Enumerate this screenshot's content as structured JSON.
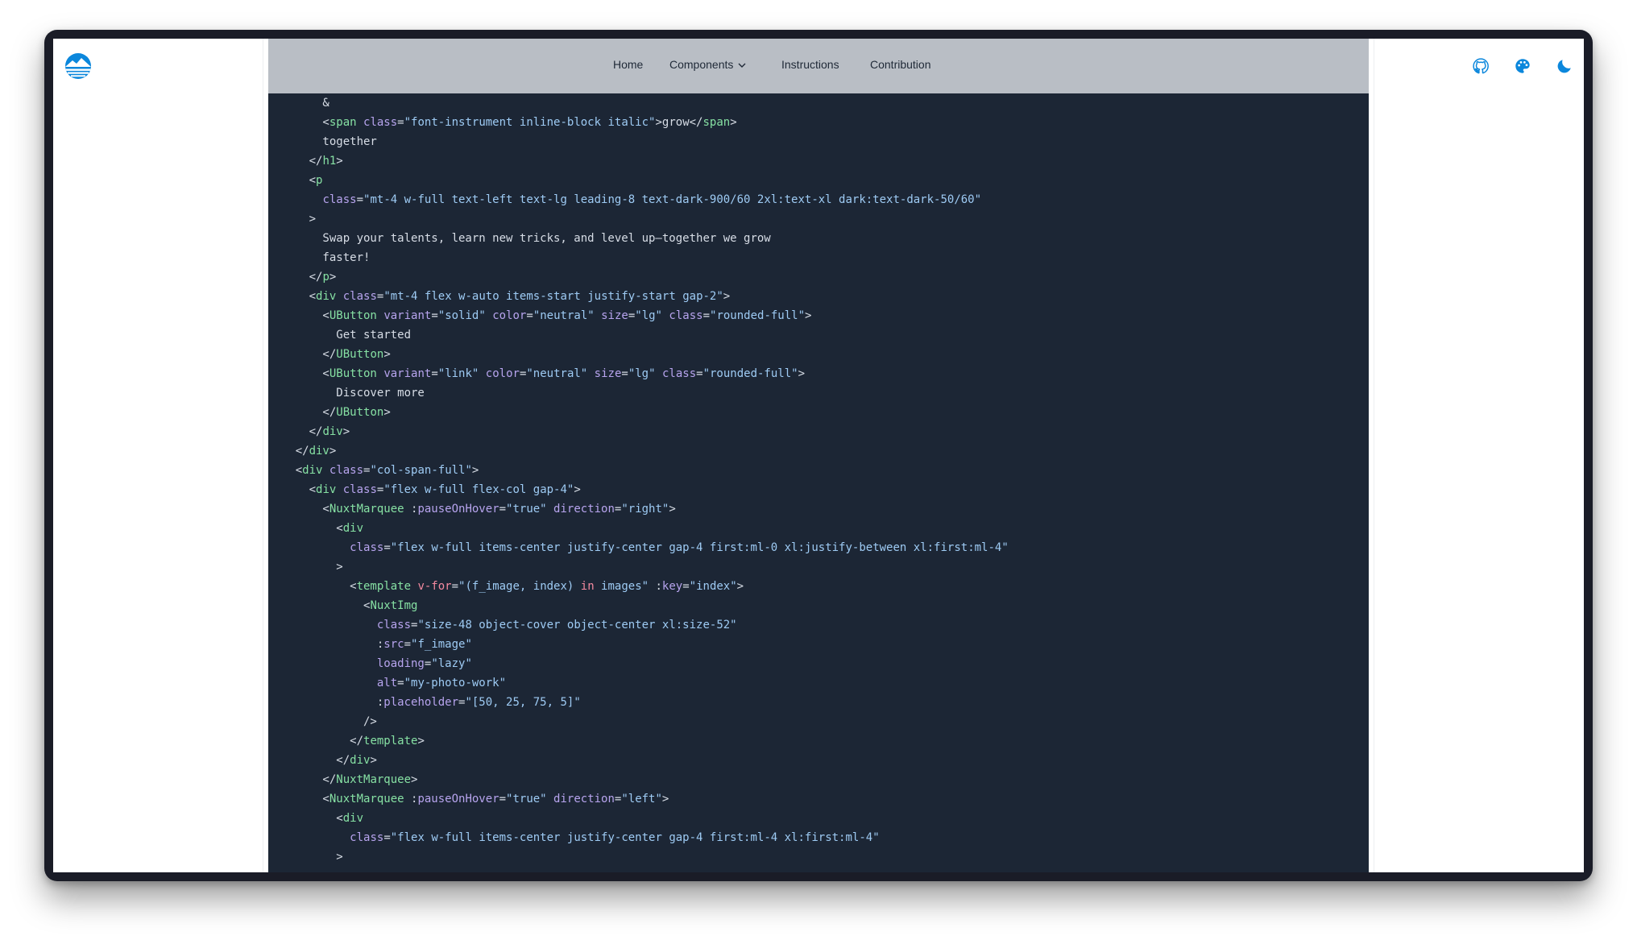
{
  "nav": {
    "home": "Home",
    "components": "Components",
    "instructions": "Instructions",
    "contribution": "Contribution"
  },
  "icons": {
    "logo": "cloud-sun-logo",
    "github": "github-icon",
    "palette": "palette-icon",
    "theme": "moon-icon"
  },
  "colors": {
    "accent": "#0b87dc",
    "code_background": "#1c2635",
    "tag": "#86e0a3",
    "attribute": "#b7a4ee",
    "string": "#9ecbf4",
    "keyword": "#f58aa0",
    "text": "#d7dde6"
  },
  "code": {
    "lines": [
      [
        [
          "t",
          "        &"
        ]
      ],
      [
        [
          "t",
          "        <"
        ],
        [
          "tag",
          "span"
        ],
        [
          "t",
          " "
        ],
        [
          "attr",
          "class"
        ],
        [
          "t",
          "="
        ],
        [
          "val",
          "\"font-instrument inline-block italic\""
        ],
        [
          "t",
          ">grow</"
        ],
        [
          "tag",
          "span"
        ],
        [
          "t",
          ">"
        ]
      ],
      [
        [
          "t",
          "        together"
        ]
      ],
      [
        [
          "t",
          "      </"
        ],
        [
          "tag",
          "h1"
        ],
        [
          "t",
          ">"
        ]
      ],
      [
        [
          "t",
          "      <"
        ],
        [
          "tag",
          "p"
        ]
      ],
      [
        [
          "t",
          "        "
        ],
        [
          "attr",
          "class"
        ],
        [
          "t",
          "="
        ],
        [
          "val",
          "\"mt-4 w-full text-left text-lg leading-8 text-dark-900/60 2xl:text-xl dark:text-dark-50/60\""
        ]
      ],
      [
        [
          "t",
          "      >"
        ]
      ],
      [
        [
          "t",
          "        Swap your talents, learn new tricks, and level up—together we grow"
        ]
      ],
      [
        [
          "t",
          "        faster!"
        ]
      ],
      [
        [
          "t",
          "      </"
        ],
        [
          "tag",
          "p"
        ],
        [
          "t",
          ">"
        ]
      ],
      [
        [
          "t",
          "      <"
        ],
        [
          "tag",
          "div"
        ],
        [
          "t",
          " "
        ],
        [
          "attr",
          "class"
        ],
        [
          "t",
          "="
        ],
        [
          "val",
          "\"mt-4 flex w-auto items-start justify-start gap-2\""
        ],
        [
          "t",
          ">"
        ]
      ],
      [
        [
          "t",
          "        <"
        ],
        [
          "tag",
          "UButton"
        ],
        [
          "t",
          " "
        ],
        [
          "attr",
          "variant"
        ],
        [
          "t",
          "="
        ],
        [
          "val",
          "\"solid\""
        ],
        [
          "t",
          " "
        ],
        [
          "attr",
          "color"
        ],
        [
          "t",
          "="
        ],
        [
          "val",
          "\"neutral\""
        ],
        [
          "t",
          " "
        ],
        [
          "attr",
          "size"
        ],
        [
          "t",
          "="
        ],
        [
          "val",
          "\"lg\""
        ],
        [
          "t",
          " "
        ],
        [
          "attr",
          "class"
        ],
        [
          "t",
          "="
        ],
        [
          "val",
          "\"rounded-full\""
        ],
        [
          "t",
          ">"
        ]
      ],
      [
        [
          "t",
          "          Get started"
        ]
      ],
      [
        [
          "t",
          "        </"
        ],
        [
          "tag",
          "UButton"
        ],
        [
          "t",
          ">"
        ]
      ],
      [
        [
          "t",
          "        <"
        ],
        [
          "tag",
          "UButton"
        ],
        [
          "t",
          " "
        ],
        [
          "attr",
          "variant"
        ],
        [
          "t",
          "="
        ],
        [
          "val",
          "\"link\""
        ],
        [
          "t",
          " "
        ],
        [
          "attr",
          "color"
        ],
        [
          "t",
          "="
        ],
        [
          "val",
          "\"neutral\""
        ],
        [
          "t",
          " "
        ],
        [
          "attr",
          "size"
        ],
        [
          "t",
          "="
        ],
        [
          "val",
          "\"lg\""
        ],
        [
          "t",
          " "
        ],
        [
          "attr",
          "class"
        ],
        [
          "t",
          "="
        ],
        [
          "val",
          "\"rounded-full\""
        ],
        [
          "t",
          ">"
        ]
      ],
      [
        [
          "t",
          "          Discover more"
        ]
      ],
      [
        [
          "t",
          "        </"
        ],
        [
          "tag",
          "UButton"
        ],
        [
          "t",
          ">"
        ]
      ],
      [
        [
          "t",
          "      </"
        ],
        [
          "tag",
          "div"
        ],
        [
          "t",
          ">"
        ]
      ],
      [
        [
          "t",
          "    </"
        ],
        [
          "tag",
          "div"
        ],
        [
          "t",
          ">"
        ]
      ],
      [
        [
          "t",
          "    <"
        ],
        [
          "tag",
          "div"
        ],
        [
          "t",
          " "
        ],
        [
          "attr",
          "class"
        ],
        [
          "t",
          "="
        ],
        [
          "val",
          "\"col-span-full\""
        ],
        [
          "t",
          ">"
        ]
      ],
      [
        [
          "t",
          "      <"
        ],
        [
          "tag",
          "div"
        ],
        [
          "t",
          " "
        ],
        [
          "attr",
          "class"
        ],
        [
          "t",
          "="
        ],
        [
          "val",
          "\"flex w-full flex-col gap-4\""
        ],
        [
          "t",
          ">"
        ]
      ],
      [
        [
          "t",
          "        <"
        ],
        [
          "tag",
          "NuxtMarquee"
        ],
        [
          "t",
          " :"
        ],
        [
          "attr",
          "pauseOnHover"
        ],
        [
          "t",
          "="
        ],
        [
          "val",
          "\"true\""
        ],
        [
          "t",
          " "
        ],
        [
          "attr",
          "direction"
        ],
        [
          "t",
          "="
        ],
        [
          "val",
          "\"right\""
        ],
        [
          "t",
          ">"
        ]
      ],
      [
        [
          "t",
          "          <"
        ],
        [
          "tag",
          "div"
        ]
      ],
      [
        [
          "t",
          "            "
        ],
        [
          "attr",
          "class"
        ],
        [
          "t",
          "="
        ],
        [
          "val",
          "\"flex w-full items-center justify-center gap-4 first:ml-0 xl:justify-between xl:first:ml-4\""
        ]
      ],
      [
        [
          "t",
          "          >"
        ]
      ],
      [
        [
          "t",
          "            <"
        ],
        [
          "tag",
          "template"
        ],
        [
          "t",
          " "
        ],
        [
          "kw",
          "v-for"
        ],
        [
          "t",
          "="
        ],
        [
          "val",
          "\"(f_image, index) "
        ],
        [
          "kw",
          "in"
        ],
        [
          "val",
          " images\""
        ],
        [
          "t",
          " :"
        ],
        [
          "attr",
          "key"
        ],
        [
          "t",
          "="
        ],
        [
          "val",
          "\"index\""
        ],
        [
          "t",
          ">"
        ]
      ],
      [
        [
          "t",
          "              <"
        ],
        [
          "tag",
          "NuxtImg"
        ]
      ],
      [
        [
          "t",
          "                "
        ],
        [
          "attr",
          "class"
        ],
        [
          "t",
          "="
        ],
        [
          "val",
          "\"size-48 object-cover object-center xl:size-52\""
        ]
      ],
      [
        [
          "t",
          "                :"
        ],
        [
          "attr",
          "src"
        ],
        [
          "t",
          "="
        ],
        [
          "val",
          "\"f_image\""
        ]
      ],
      [
        [
          "t",
          "                "
        ],
        [
          "attr",
          "loading"
        ],
        [
          "t",
          "="
        ],
        [
          "val",
          "\"lazy\""
        ]
      ],
      [
        [
          "t",
          "                "
        ],
        [
          "attr",
          "alt"
        ],
        [
          "t",
          "="
        ],
        [
          "val",
          "\"my-photo-work\""
        ]
      ],
      [
        [
          "t",
          "                :"
        ],
        [
          "attr",
          "placeholder"
        ],
        [
          "t",
          "="
        ],
        [
          "val",
          "\"[50, 25, 75, 5]\""
        ]
      ],
      [
        [
          "t",
          "              />"
        ]
      ],
      [
        [
          "t",
          "            </"
        ],
        [
          "tag",
          "template"
        ],
        [
          "t",
          ">"
        ]
      ],
      [
        [
          "t",
          "          </"
        ],
        [
          "tag",
          "div"
        ],
        [
          "t",
          ">"
        ]
      ],
      [
        [
          "t",
          "        </"
        ],
        [
          "tag",
          "NuxtMarquee"
        ],
        [
          "t",
          ">"
        ]
      ],
      [
        [
          "t",
          "        <"
        ],
        [
          "tag",
          "NuxtMarquee"
        ],
        [
          "t",
          " :"
        ],
        [
          "attr",
          "pauseOnHover"
        ],
        [
          "t",
          "="
        ],
        [
          "val",
          "\"true\""
        ],
        [
          "t",
          " "
        ],
        [
          "attr",
          "direction"
        ],
        [
          "t",
          "="
        ],
        [
          "val",
          "\"left\""
        ],
        [
          "t",
          ">"
        ]
      ],
      [
        [
          "t",
          "          <"
        ],
        [
          "tag",
          "div"
        ]
      ],
      [
        [
          "t",
          "            "
        ],
        [
          "attr",
          "class"
        ],
        [
          "t",
          "="
        ],
        [
          "val",
          "\"flex w-full items-center justify-center gap-4 first:ml-4 xl:first:ml-4\""
        ]
      ],
      [
        [
          "t",
          "          >"
        ]
      ]
    ]
  }
}
